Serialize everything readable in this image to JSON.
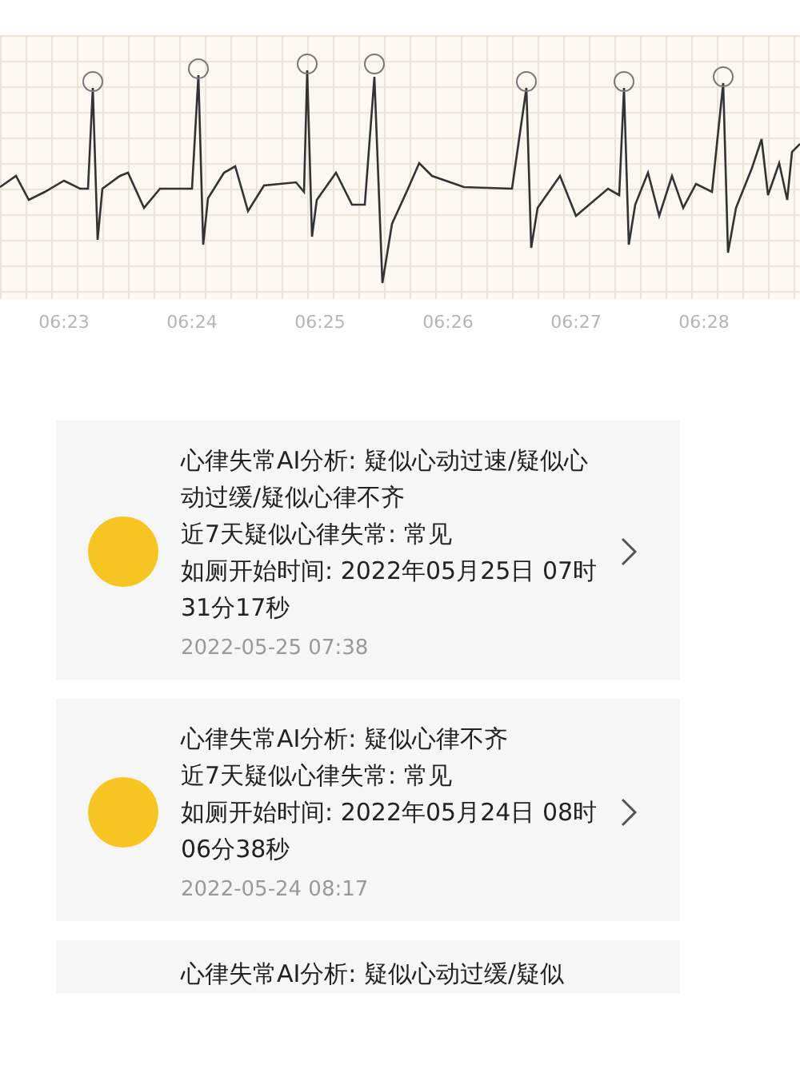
{
  "chart": {
    "time_labels": [
      "06:23",
      "06:24",
      "06:25",
      "06:26",
      "06:27",
      "06:28"
    ]
  },
  "records": [
    {
      "kind": "full",
      "analysis": "心律失常AI分析: 疑似心动过速/疑似心动过缓/疑似心律不齐",
      "frequency": "近7天疑似心律失常: 常见",
      "start_time": "如厕开始时间: 2022年05月25日 07时31分17秒",
      "date": "2022-05-25 07:38"
    },
    {
      "kind": "full",
      "analysis": "心律失常AI分析: 疑似心律不齐",
      "frequency": "近7天疑似心律失常: 常见",
      "start_time": "如厕开始时间: 2022年05月24日 08时06分38秒",
      "date": "2022-05-24 08:17"
    },
    {
      "kind": "partial",
      "analysis": "心律失常AI分析: 疑似心动过缓/疑似"
    }
  ]
}
